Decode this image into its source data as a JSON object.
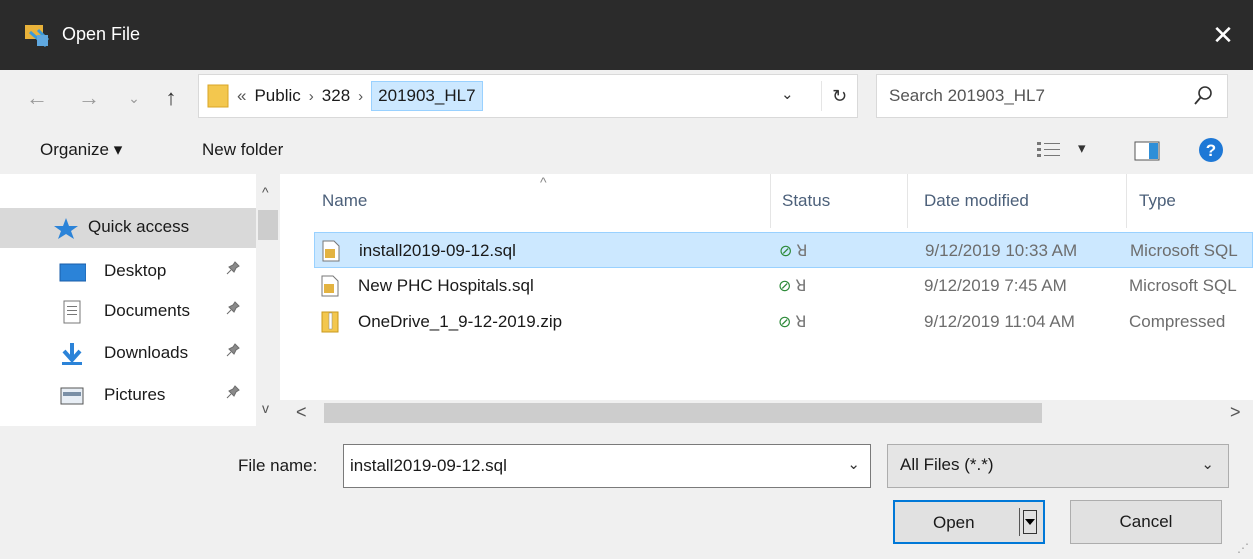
{
  "window": {
    "title": "Open File",
    "close_glyph": "✕"
  },
  "nav": {
    "back_glyph": "←",
    "forward_glyph": "→",
    "recent_glyph": "⌄",
    "up_glyph": "↑"
  },
  "address": {
    "overflow": "«",
    "crumbs": [
      "Public",
      "328",
      "201903_HL7"
    ],
    "separator": "›",
    "dropdown_glyph": "⌄",
    "refresh_glyph": "↻"
  },
  "search": {
    "placeholder": "Search 201903_HL7"
  },
  "toolbar": {
    "organize_label": "Organize ▾",
    "new_folder_label": "New folder",
    "view_dropdown_glyph": "▾"
  },
  "sidebar": {
    "items": [
      {
        "label": "Quick access",
        "icon": "star-icon"
      },
      {
        "label": "Desktop",
        "icon": "desktop-icon",
        "pin": "📌"
      },
      {
        "label": "Documents",
        "icon": "documents-icon",
        "pin": "📌"
      },
      {
        "label": "Downloads",
        "icon": "downloads-icon",
        "pin": "📌"
      },
      {
        "label": "Pictures",
        "icon": "pictures-icon",
        "pin": "📌"
      }
    ],
    "scroll_up": "^",
    "scroll_down": "v"
  },
  "columns": {
    "name": "Name",
    "status": "Status",
    "date": "Date modified",
    "type": "Type",
    "sort_glyph": "^"
  },
  "files": [
    {
      "name": "install2019-09-12.sql",
      "status": "⊘",
      "date": "9/12/2019 10:33 AM",
      "type": "Microsoft SQL",
      "icon": "sql-file-icon"
    },
    {
      "name": "New PHC Hospitals.sql",
      "status": "⊘",
      "date": "9/12/2019 7:45 AM",
      "type": "Microsoft SQL",
      "icon": "sql-file-icon"
    },
    {
      "name": "OneDrive_1_9-12-2019.zip",
      "status": "⊘",
      "date": "9/12/2019 11:04 AM",
      "type": "Compressed",
      "icon": "zip-file-icon"
    }
  ],
  "status_person": "ꓤ",
  "hscroll": {
    "left": "<",
    "right": ">"
  },
  "bottom": {
    "file_name_label": "File name:",
    "file_name_value": "install2019-09-12.sql",
    "file_type_value": "All Files (*.*)",
    "dropdown_glyph": "⌄",
    "open_label": "Open",
    "cancel_label": "Cancel"
  },
  "colors": {
    "selection_bg": "#cce8ff",
    "selection_border": "#99d1ff",
    "accent": "#0078d7",
    "titlebar": "#2b2b2b"
  }
}
